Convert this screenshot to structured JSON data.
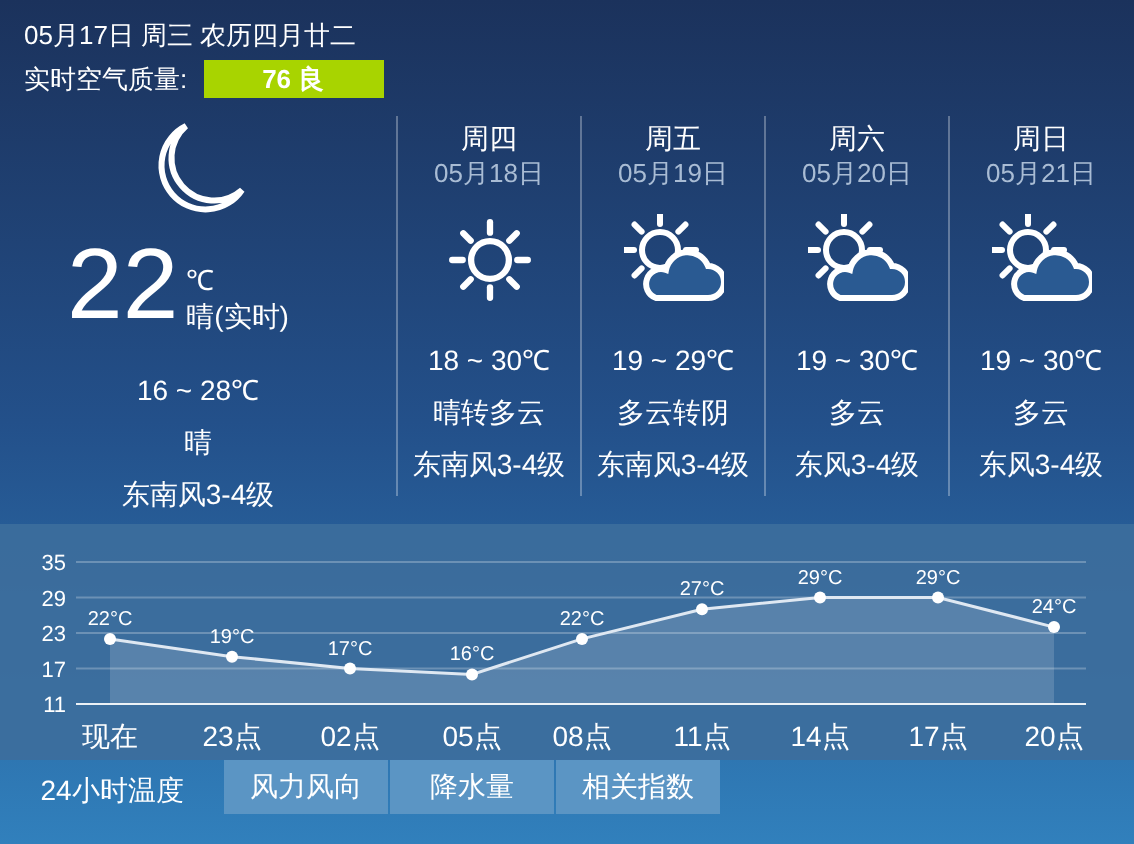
{
  "header": {
    "date_line": "05月17日 周三 农历四月廿二",
    "aqi_label": "实时空气质量:",
    "aqi_value": "76 良"
  },
  "current": {
    "kind": "moon",
    "temp": "22",
    "unit": "℃",
    "desc": "晴(实时)",
    "range": "16 ~ 28℃",
    "weather": "晴",
    "wind": "东南风3-4级"
  },
  "forecast": [
    {
      "day": "周四",
      "date": "05月18日",
      "kind": "sunny",
      "range": "18 ~ 30℃",
      "weather": "晴转多云",
      "wind": "东南风3-4级"
    },
    {
      "day": "周五",
      "date": "05月19日",
      "kind": "partly_cloudy",
      "range": "19 ~ 29℃",
      "weather": "多云转阴",
      "wind": "东南风3-4级"
    },
    {
      "day": "周六",
      "date": "05月20日",
      "kind": "partly_cloudy",
      "range": "19 ~ 30℃",
      "weather": "多云",
      "wind": "东风3-4级"
    },
    {
      "day": "周日",
      "date": "05月21日",
      "kind": "partly_cloudy",
      "range": "19 ~ 30℃",
      "weather": "多云",
      "wind": "东风3-4级"
    }
  ],
  "chart_data": {
    "type": "area",
    "categories": [
      "现在",
      "23点",
      "02点",
      "05点",
      "08点",
      "11点",
      "14点",
      "17点",
      "20点"
    ],
    "values": [
      22,
      19,
      17,
      16,
      22,
      27,
      29,
      29,
      24
    ],
    "value_labels": [
      "22°C",
      "19°C",
      "17°C",
      "16°C",
      "22°C",
      "27°C",
      "29°C",
      "29°C",
      "24°C"
    ],
    "ylim": [
      11,
      35
    ],
    "yticks": [
      11,
      17,
      23,
      29,
      35
    ],
    "grid": true
  },
  "tabs": [
    {
      "label": "24小时温度",
      "selected": true
    },
    {
      "label": "风力风向",
      "selected": false
    },
    {
      "label": "降水量",
      "selected": false
    },
    {
      "label": "相关指数",
      "selected": false
    }
  ]
}
